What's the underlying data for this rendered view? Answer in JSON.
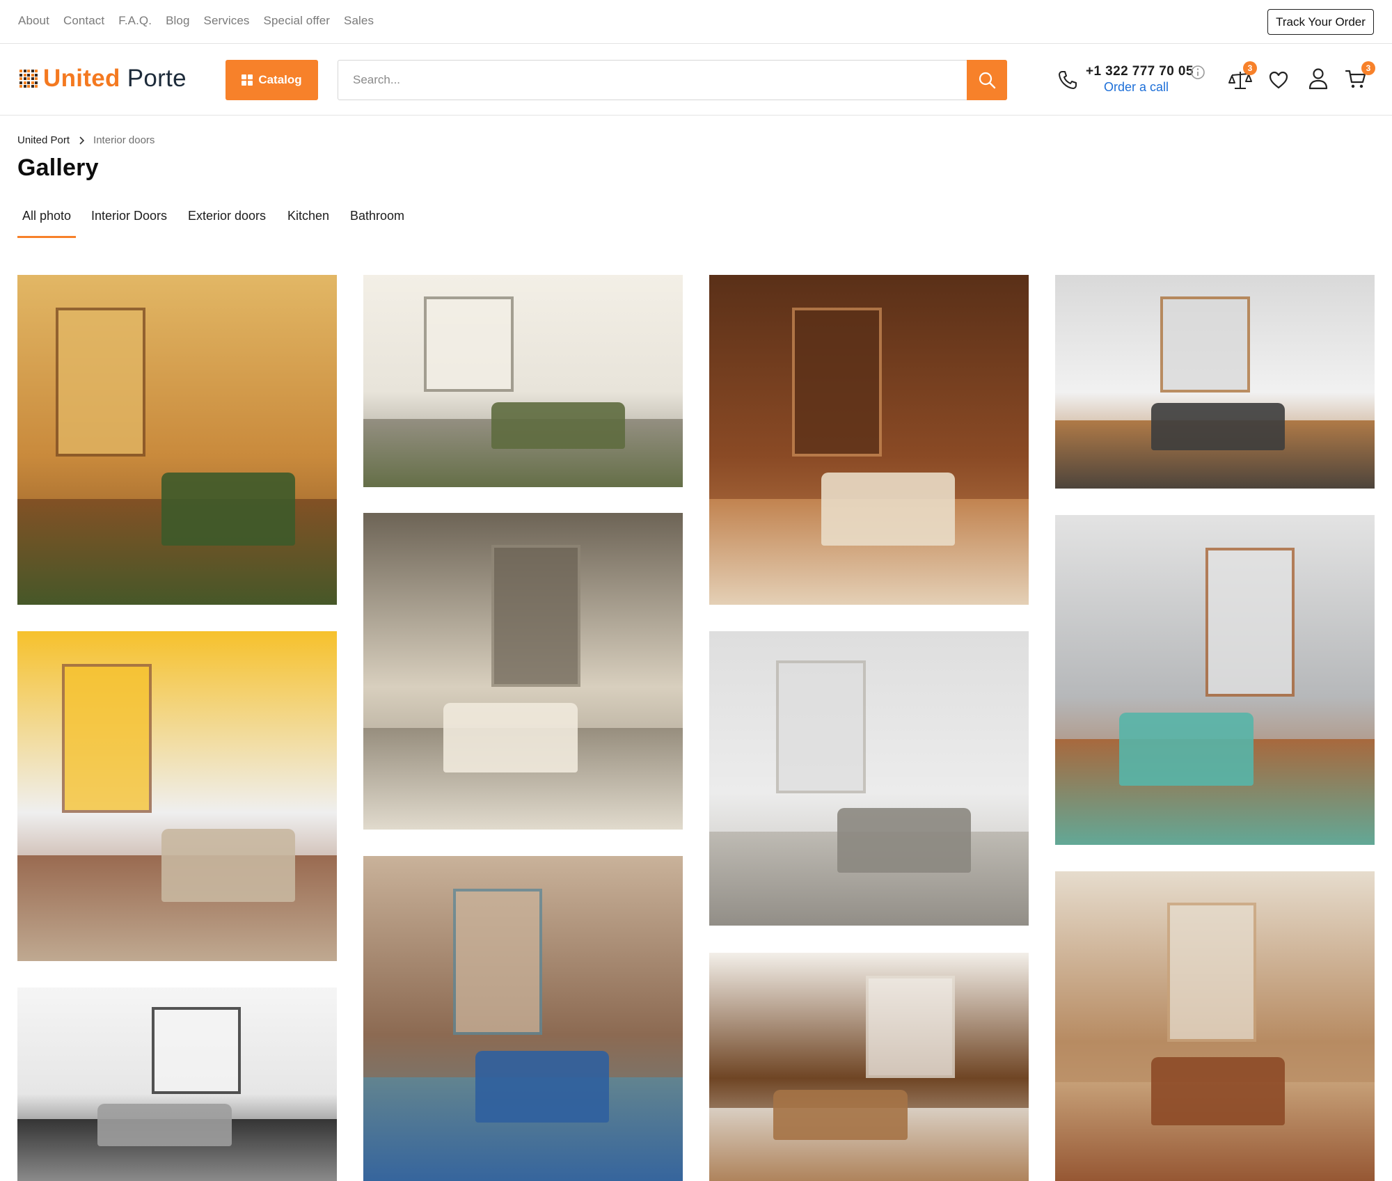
{
  "topnav": {
    "links": [
      "About",
      "Contact",
      "F.A.Q.",
      "Blog",
      "Services",
      "Special offer",
      "Sales"
    ],
    "track_order": "Track Your Order"
  },
  "header": {
    "logo_brand": "United",
    "logo_rest": "Porte",
    "catalog_label": "Catalog",
    "search_placeholder": "Search...",
    "phone": "+1 322 777 70 05",
    "order_call": "Order a call",
    "compare_count": "3",
    "cart_count": "3",
    "accent_color": "#f7812a"
  },
  "breadcrumb": {
    "home": "United Port",
    "current": "Interior doors"
  },
  "page_title": "Gallery",
  "tabs": [
    "All photo",
    "Interior Doors",
    "Exterior doors",
    "Kitchen",
    "Bathroom"
  ],
  "active_tab": "All photo",
  "gallery": {
    "photos": [
      {
        "name": "living-room-plants-photo",
        "palette": [
          "#c98a3c",
          "#7a4a22",
          "#3d5a2a",
          "#e2b765"
        ]
      },
      {
        "name": "sofa-living-room-photo",
        "palette": [
          "#e8e4da",
          "#8a8577",
          "#5e6b3f",
          "#f3efe6"
        ]
      },
      {
        "name": "window-door-room-photo",
        "palette": [
          "#8a4a25",
          "#c88a55",
          "#e9dcc7",
          "#5a3018"
        ]
      },
      {
        "name": "white-wood-kitchen-photo",
        "palette": [
          "#f1f1f1",
          "#a86c33",
          "#3d3d3d",
          "#d9d9d9"
        ]
      },
      {
        "name": "round-bed-bedroom-photo",
        "palette": [
          "#d8cfbe",
          "#8f8676",
          "#efe9dc",
          "#6d6456"
        ]
      },
      {
        "name": "kitchen-bar-stools-photo",
        "palette": [
          "#b6b8ba",
          "#a65f2e",
          "#56b5a9",
          "#e3e3e3"
        ]
      },
      {
        "name": "white-kitchen-dining-photo",
        "palette": [
          "#efefef",
          "#8f5a3d",
          "#c8b7a0",
          "#f6c12c"
        ]
      },
      {
        "name": "white-bedroom-photo",
        "palette": [
          "#ececec",
          "#b9b5ad",
          "#8b8780",
          "#dedede"
        ]
      },
      {
        "name": "loft-kitchen-photo",
        "palette": [
          "#8c6a52",
          "#5d8797",
          "#2f5f9e",
          "#c9b29a"
        ]
      },
      {
        "name": "living-room-fan-photo",
        "palette": [
          "#b78b62",
          "#c8a27a",
          "#8d4a27",
          "#e6dccd"
        ]
      },
      {
        "name": "glass-door-bedroom-photo",
        "palette": [
          "#e6e6e6",
          "#1f1f1f",
          "#9d9d9d",
          "#f5f5f5"
        ]
      },
      {
        "name": "wooden-bathroom-photo",
        "palette": [
          "#6f4524",
          "#e6dfd5",
          "#a57346",
          "#f3efe9"
        ]
      }
    ]
  }
}
